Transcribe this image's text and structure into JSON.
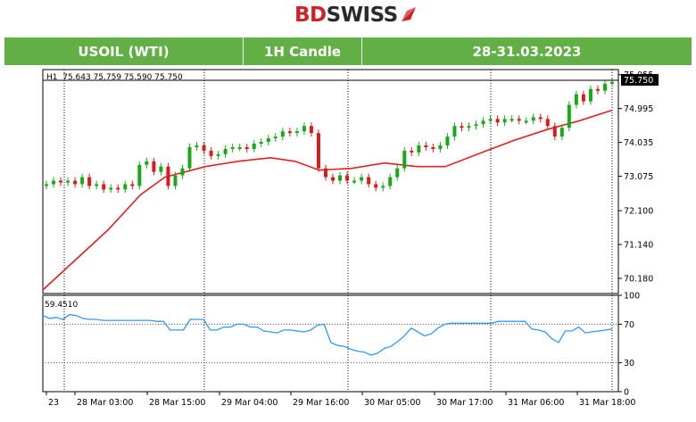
{
  "brand": {
    "left": "BD",
    "right": "SWISS",
    "accent": "#cc2229"
  },
  "banner": {
    "symbol": "USOIL (WTI)",
    "timeframe": "1H Candle",
    "dates": "28-31.03.2023",
    "color": "#62b045"
  },
  "chart_data": {
    "type": "candlestick",
    "info": "H1  75.643 75.759 75.590 75.750",
    "last_price_label": "75.750",
    "last_price": 75.75,
    "price_ticks": [
      "75.955",
      "74.995",
      "74.035",
      "73.075",
      "72.100",
      "71.140",
      "70.180"
    ],
    "price_ylim": [
      69.75,
      76.1
    ],
    "x_ticks": [
      "23",
      "28 Mar 03:00",
      "28 Mar 15:00",
      "29 Mar 04:00",
      "29 Mar 16:00",
      "30 Mar 05:00",
      "30 Mar 17:00",
      "31 Mar 06:00",
      "31 Mar 18:00"
    ],
    "colors": {
      "up": "#1aa81a",
      "down": "#d81c1c",
      "ma": "#e02020",
      "osc": "#3399ee"
    },
    "candles_close": [
      72.85,
      72.95,
      72.9,
      72.95,
      72.85,
      73.05,
      72.8,
      72.85,
      72.7,
      72.75,
      72.7,
      72.85,
      72.8,
      73.4,
      73.5,
      73.2,
      73.35,
      72.8,
      73.1,
      73.3,
      73.9,
      73.95,
      73.8,
      73.65,
      73.7,
      73.85,
      73.9,
      73.9,
      73.85,
      74,
      74.05,
      74.15,
      74.2,
      74.35,
      74.3,
      74.35,
      74.5,
      74.3,
      73.3,
      73.05,
      72.95,
      73.1,
      72.95,
      72.95,
      73.05,
      72.85,
      72.75,
      72.8,
      73.05,
      73.3,
      73.8,
      73.75,
      73.95,
      73.9,
      73.85,
      73.95,
      74.2,
      74.5,
      74.45,
      74.5,
      74.55,
      74.65,
      74.7,
      74.6,
      74.7,
      74.7,
      74.65,
      74.65,
      74.75,
      74.7,
      74.5,
      74.2,
      74.45,
      75.1,
      75.4,
      75.2,
      75.55,
      75.5,
      75.7,
      75.75
    ],
    "moving_average": [
      {
        "i": 0,
        "v": 69.85
      },
      {
        "i": 8,
        "v": 70.7
      },
      {
        "i": 16,
        "v": 71.55
      },
      {
        "i": 24,
        "v": 72.55
      },
      {
        "i": 30,
        "v": 73.05
      },
      {
        "i": 40,
        "v": 73.35
      },
      {
        "i": 48,
        "v": 73.5
      },
      {
        "i": 56,
        "v": 73.6
      },
      {
        "i": 62,
        "v": 73.5
      },
      {
        "i": 68,
        "v": 73.25
      },
      {
        "i": 76,
        "v": 73.3
      },
      {
        "i": 84,
        "v": 73.45
      },
      {
        "i": 92,
        "v": 73.35
      },
      {
        "i": 99,
        "v": 73.35
      },
      {
        "i": 108,
        "v": 73.75
      },
      {
        "i": 116,
        "v": 74.1
      },
      {
        "i": 124,
        "v": 74.4
      },
      {
        "i": 132,
        "v": 74.65
      },
      {
        "i": 140,
        "v": 74.95
      }
    ],
    "oscillator": {
      "value_label": "59.4510",
      "ticks": [
        "100",
        "70",
        "30",
        "0"
      ],
      "levels": [
        70,
        30
      ],
      "ylim": [
        0,
        100
      ],
      "values": [
        79,
        76,
        77,
        75,
        80,
        79,
        76,
        75,
        75,
        74,
        74,
        74,
        74,
        74,
        74,
        74,
        74,
        73,
        73,
        64,
        64,
        64,
        75,
        75,
        75,
        64,
        64,
        67,
        67,
        70,
        70,
        67,
        67,
        63,
        62,
        61,
        64,
        64,
        63,
        62,
        64,
        69,
        70,
        51,
        48,
        47,
        44,
        42,
        41,
        38,
        40,
        45,
        47,
        52,
        58,
        66,
        62,
        58,
        60,
        66,
        70,
        71,
        71,
        71,
        71,
        71,
        71,
        71,
        73,
        73,
        73,
        73,
        73,
        65,
        64,
        62,
        55,
        51,
        63,
        63,
        67,
        61,
        62,
        63,
        64,
        65
      ]
    }
  }
}
